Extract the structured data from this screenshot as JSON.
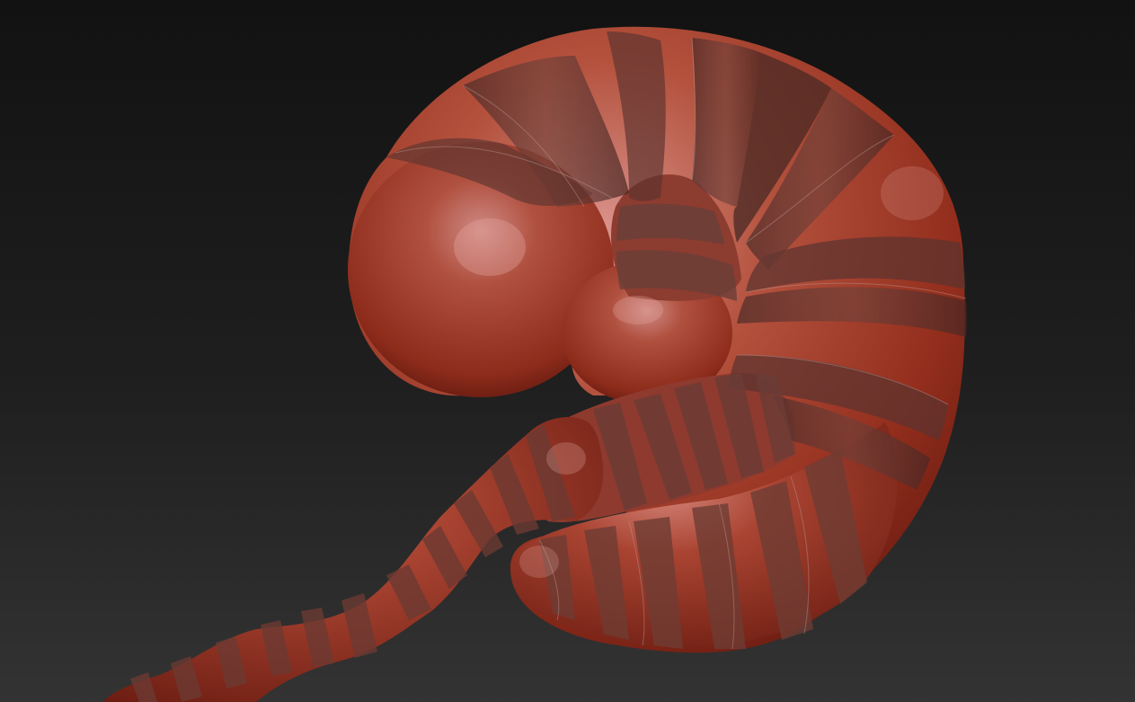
{
  "viewport": {
    "background_top": "#121212",
    "background_bottom": "#333333"
  },
  "model": {
    "subject": "segmented-worm-sculpt",
    "material": {
      "base": "#9e3a28",
      "highlight": "#d9928a",
      "shadow": "#5a1a10",
      "band_dark": "#5b3530",
      "seam_line": "#b59a95"
    }
  }
}
